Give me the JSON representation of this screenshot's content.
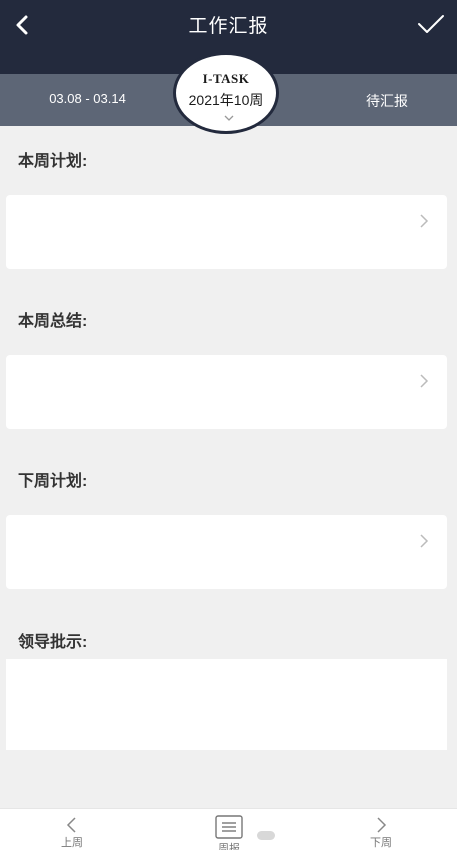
{
  "header": {
    "title": "工作汇报"
  },
  "week_bar": {
    "date_range": "03.08 - 03.14",
    "status": "待汇报",
    "badge_brand": "I-TASK",
    "badge_week": "2021年10周"
  },
  "sections": [
    {
      "label": "本周计划:"
    },
    {
      "label": "本周总结:"
    },
    {
      "label": "下周计划:"
    },
    {
      "label": "领导批示:"
    }
  ],
  "bottom_nav": {
    "prev": "上周",
    "center": "周报",
    "next": "下周"
  },
  "colors": {
    "header_bg": "#232a3d",
    "week_bar_bg": "#5d6676",
    "page_bg": "#f0f0f0"
  }
}
